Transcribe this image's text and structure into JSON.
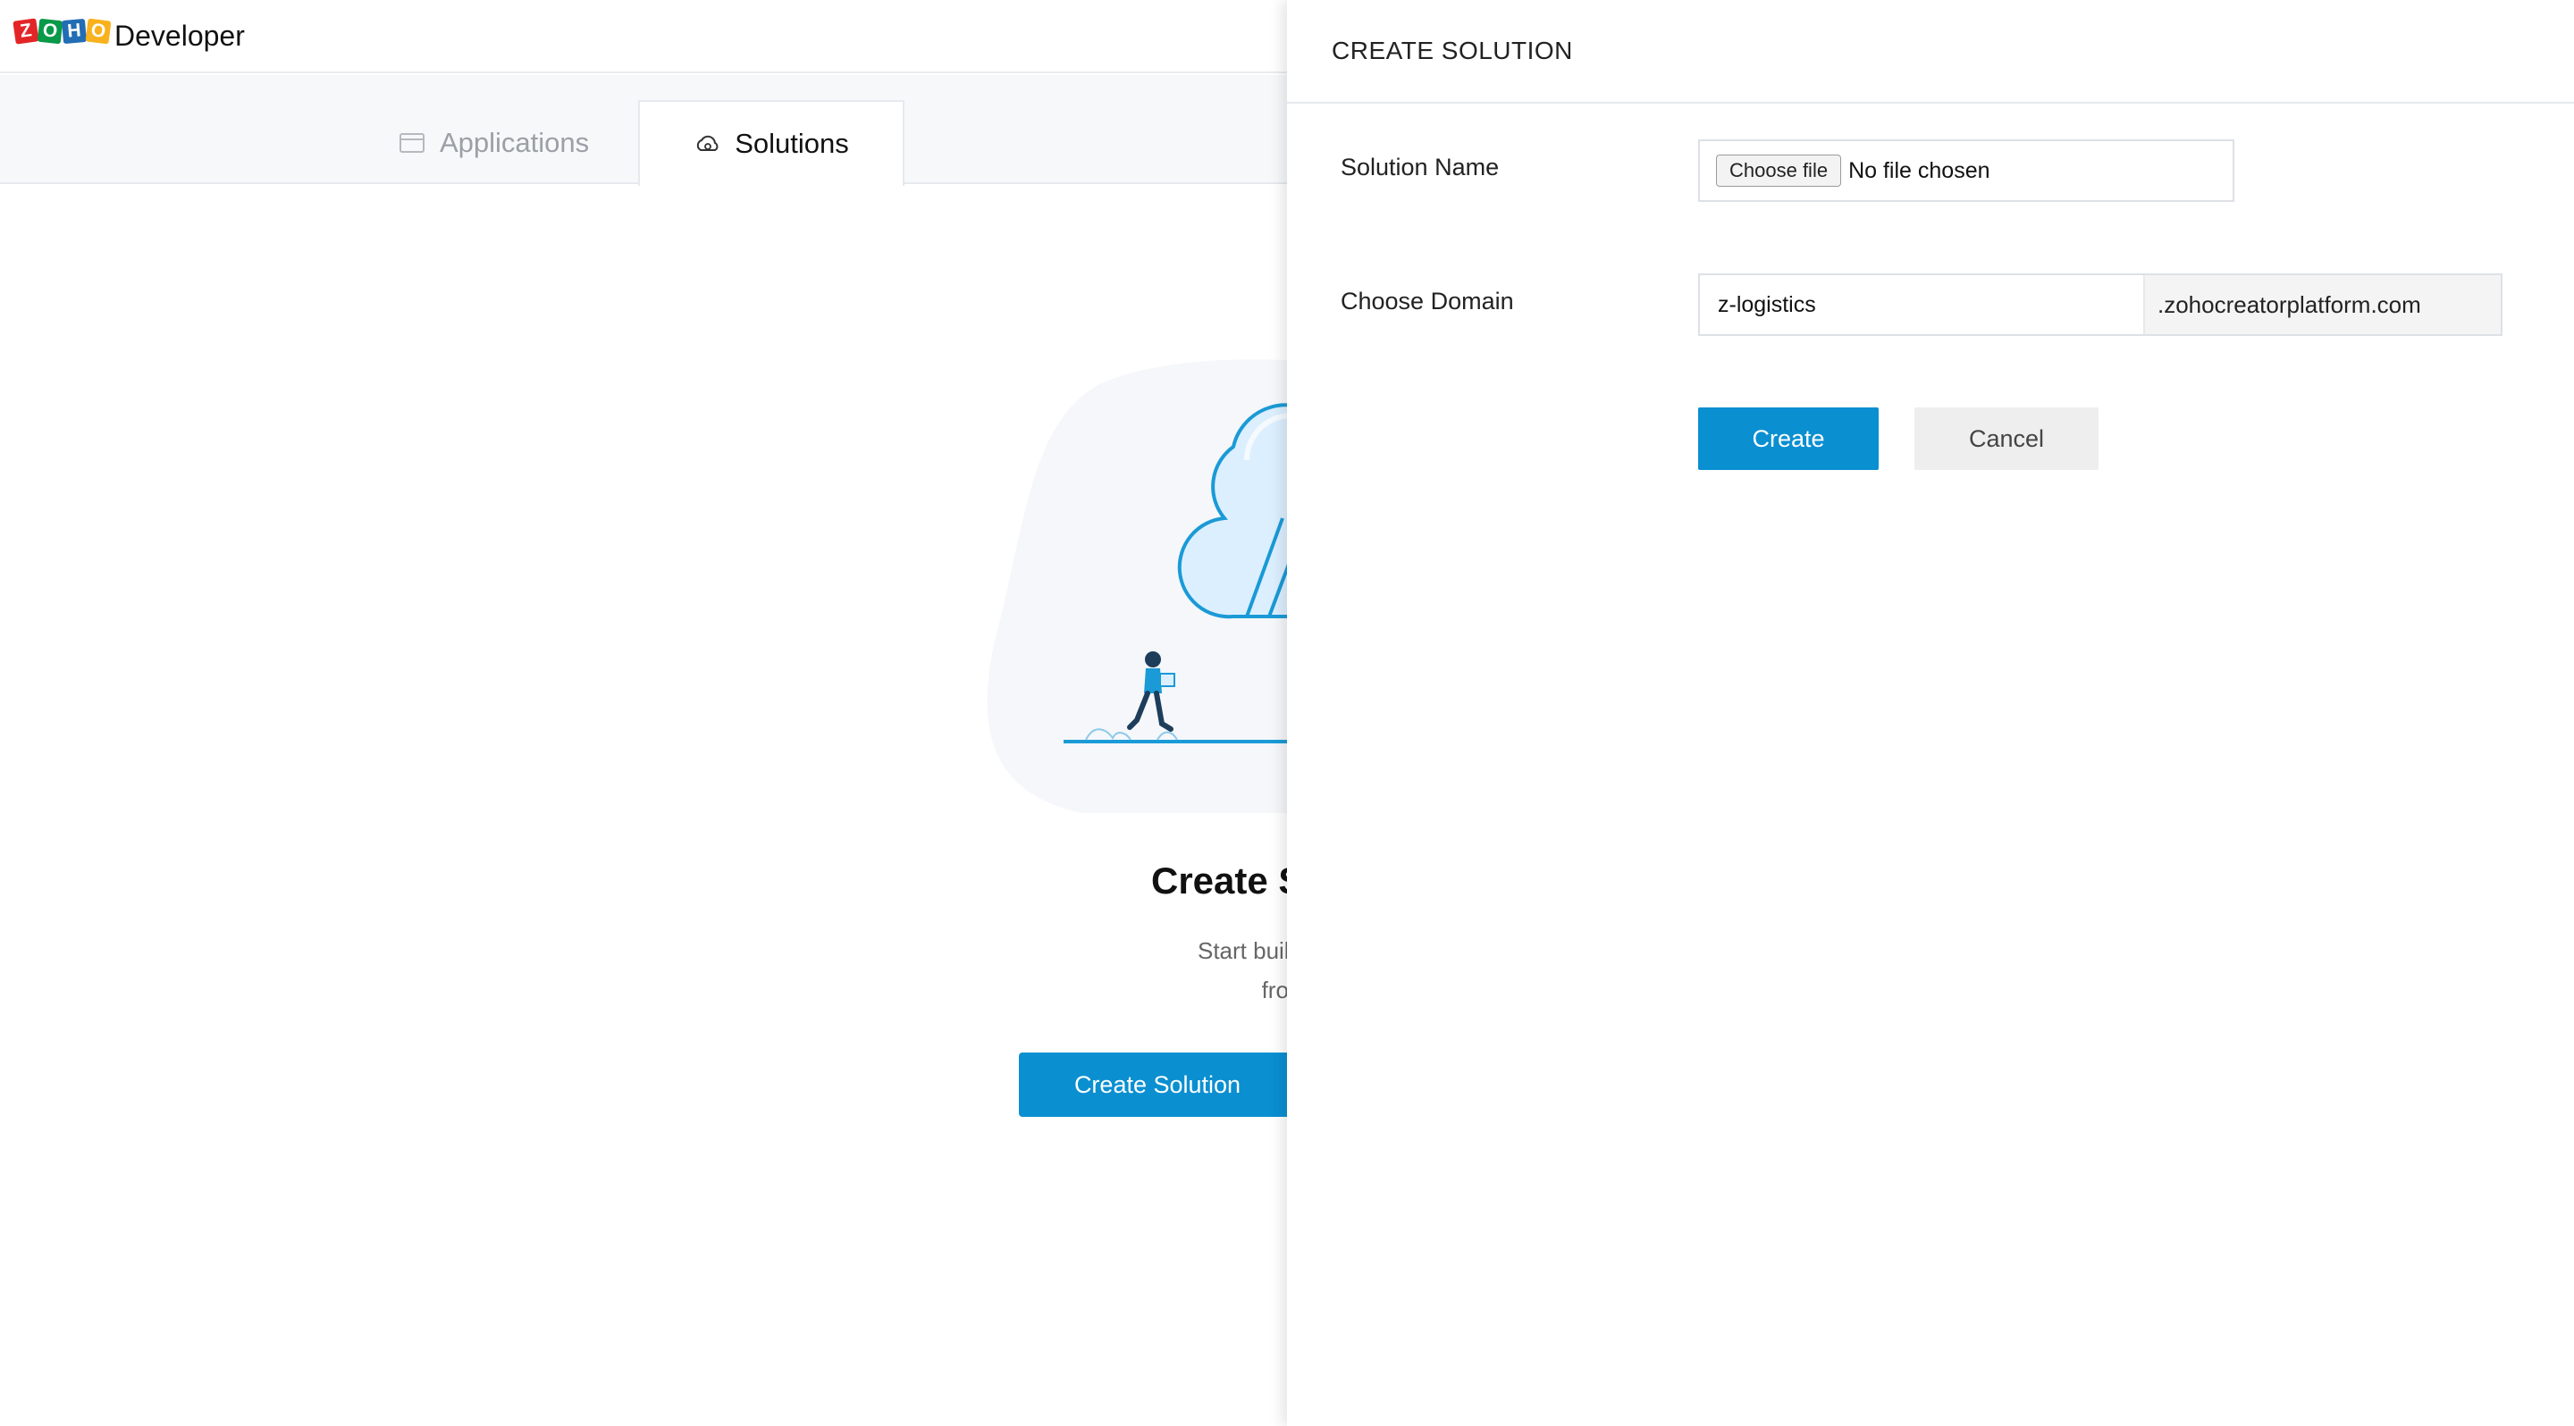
{
  "header": {
    "brand_logo_text": "ZOHO",
    "brand_letters": [
      "Z",
      "O",
      "H",
      "O"
    ],
    "product_name": "Developer"
  },
  "tabs": [
    {
      "label": "Applications",
      "icon": "window-icon",
      "active": false
    },
    {
      "label": "Solutions",
      "icon": "cloud-gear-icon",
      "active": true
    }
  ],
  "empty_state": {
    "title": "Create S",
    "description_line1": "Start building your standalone",
    "description_line2": "from scratch or in",
    "button_label": "Create Solution"
  },
  "panel": {
    "title": "CREATE SOLUTION",
    "solution_name_label": "Solution Name",
    "file_button_label": "Choose file",
    "file_status": "No file chosen",
    "domain_label": "Choose Domain",
    "domain_value": "z-logistics",
    "domain_suffix": ".zohocreatorplatform.com",
    "create_label": "Create",
    "cancel_label": "Cancel"
  },
  "colors": {
    "accent": "#0a8fd1",
    "illustration_blue": "#1a9ad6",
    "logo_red": "#e42527",
    "logo_green": "#089949",
    "logo_blue": "#226db4",
    "logo_yellow": "#f9b21d"
  }
}
